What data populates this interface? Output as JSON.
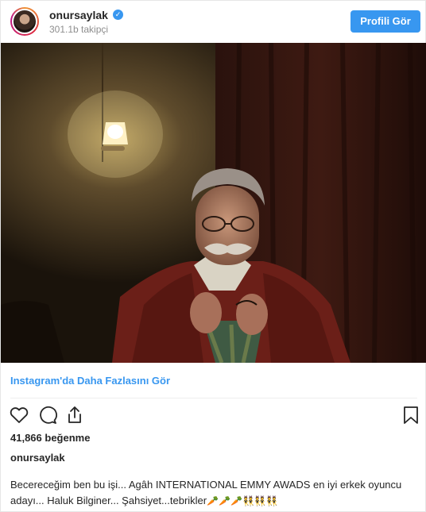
{
  "post": {
    "username": "onursaylak",
    "verified_badge": "✓",
    "followers": "301.1b takipçi",
    "profile_button": "Profili Gör",
    "more_link": "Instagram'da Daha Fazlasını Gör",
    "likes": "41,866 beğenme",
    "caption_username": "onursaylak",
    "caption_text": "Becereceğim ben bu işi... Agâh INTERNATIONAL EMMY AWADS en iyi erkek oyuncu adayı... Haluk Bilginer... Şahsiyet...tebrikler",
    "caption_emojis": "🥕🥕🥕👯👯👯"
  },
  "icons": {
    "like": "heart-icon",
    "comment": "comment-icon",
    "share": "share-icon",
    "save": "bookmark-icon",
    "verified": "verified-badge-icon"
  },
  "colors": {
    "accent": "#3897f0",
    "text": "#262626",
    "muted": "#8e8e8e"
  }
}
